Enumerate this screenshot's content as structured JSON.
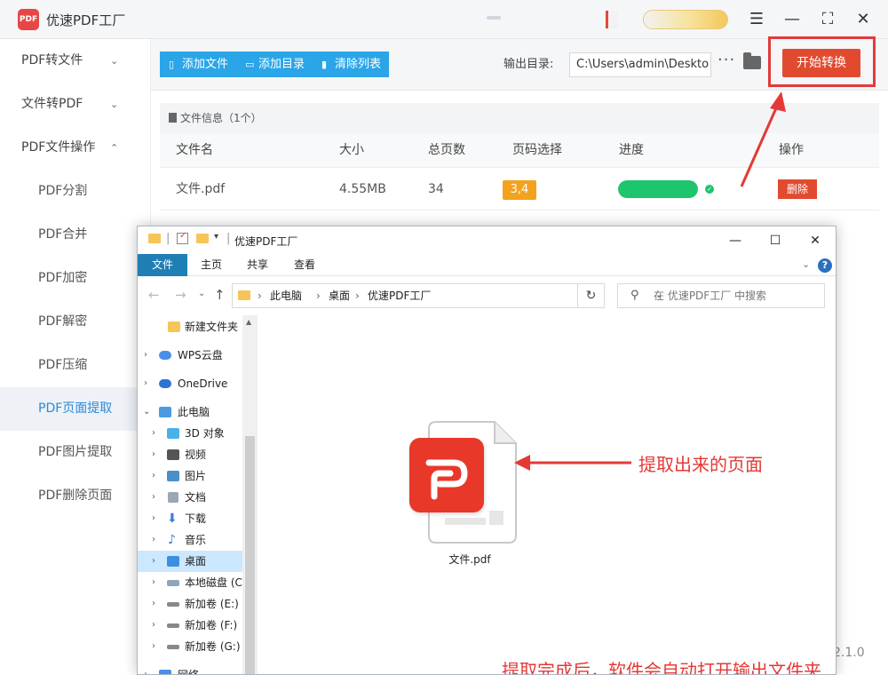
{
  "app": {
    "logo_text": "PDF",
    "title": "优速PDF工厂",
    "window_buttons": [
      "menu-icon",
      "minimize-icon",
      "maximize-icon",
      "close-icon"
    ],
    "accent": "#2aa6e8",
    "danger": "#e24a30"
  },
  "sidebar": {
    "items": [
      {
        "label": "PDF转文件",
        "expand": "⌄"
      },
      {
        "label": "文件转PDF",
        "expand": "⌄"
      },
      {
        "label": "PDF文件操作",
        "expand": "⌃"
      },
      {
        "label": "PDF分割"
      },
      {
        "label": "PDF合并"
      },
      {
        "label": "PDF加密"
      },
      {
        "label": "PDF解密"
      },
      {
        "label": "PDF压缩"
      },
      {
        "label": "PDF页面提取",
        "active": true
      },
      {
        "label": "PDF图片提取"
      },
      {
        "label": "PDF删除页面"
      }
    ]
  },
  "toolbar": {
    "add_file": "添加文件",
    "add_dir": "添加目录",
    "clear_list": "清除列表",
    "output_label": "输出目录:",
    "output_value": "C:\\Users\\admin\\Deskto",
    "more": "···",
    "start": "开始转换"
  },
  "file_info": {
    "label": "文件信息（1个）"
  },
  "table": {
    "headers": [
      "文件名",
      "大小",
      "总页数",
      "页码选择",
      "进度",
      "操作"
    ],
    "row": {
      "name": "文件.pdf",
      "size": "4.55MB",
      "pages": "34",
      "page_select": "3,4",
      "progress": 1.0,
      "action": "删除"
    }
  },
  "version": "2.1.0",
  "explorer": {
    "title": "优速PDF工厂",
    "ribbon_tabs": [
      "文件",
      "主页",
      "共享",
      "查看"
    ],
    "help": "?",
    "address": [
      "此电脑",
      "桌面",
      "优速PDF工厂"
    ],
    "search_placeholder": "在 优速PDF工厂 中搜索",
    "nav": [
      {
        "label": "新建文件夹",
        "exp": "",
        "icon": "folder-icon",
        "color": "#f6c557"
      },
      {
        "label": "WPS云盘",
        "exp": "›",
        "icon": "cloud-icon",
        "color": "#4a8fe7"
      },
      {
        "label": "OneDrive",
        "exp": "›",
        "icon": "onedrive-icon",
        "color": "#2f72d6"
      },
      {
        "label": "此电脑",
        "exp": "⌄",
        "icon": "computer-icon",
        "color": "#4a9be4"
      },
      {
        "label": "3D 对象",
        "exp": "›",
        "icon": "cube-icon",
        "color": "#4ab0e8"
      },
      {
        "label": "视频",
        "exp": "›",
        "icon": "video-icon",
        "color": "#555555"
      },
      {
        "label": "图片",
        "exp": "›",
        "icon": "picture-icon",
        "color": "#4a8fc7"
      },
      {
        "label": "文档",
        "exp": "›",
        "icon": "document-icon",
        "color": "#9aa7b5"
      },
      {
        "label": "下载",
        "exp": "›",
        "icon": "download-icon",
        "color": "#3c7fd8"
      },
      {
        "label": "音乐",
        "exp": "›",
        "icon": "music-icon",
        "color": "#3c7fd8"
      },
      {
        "label": "桌面",
        "exp": "›",
        "icon": "desktop-icon",
        "color": "#3c8fe0",
        "selected": true
      },
      {
        "label": "本地磁盘 (C",
        "exp": "›",
        "icon": "drive-icon",
        "color": "#8fa5bb"
      },
      {
        "label": "新加卷 (E:)",
        "exp": "›",
        "icon": "drive-icon",
        "color": "#888888"
      },
      {
        "label": "新加卷 (F:)",
        "exp": "›",
        "icon": "drive-icon",
        "color": "#888888"
      },
      {
        "label": "新加卷 (G:)",
        "exp": "›",
        "icon": "drive-icon",
        "color": "#888888"
      },
      {
        "label": "网络",
        "exp": "›",
        "icon": "network-icon",
        "color": "#4a8fe7"
      }
    ],
    "file": {
      "name": "文件.pdf"
    },
    "annotation_arrow_text": "提取出来的页面",
    "annotation_bottom_text": "提取完成后，软件会自动打开输出文件夹",
    "annotation_color": "#e53935"
  }
}
